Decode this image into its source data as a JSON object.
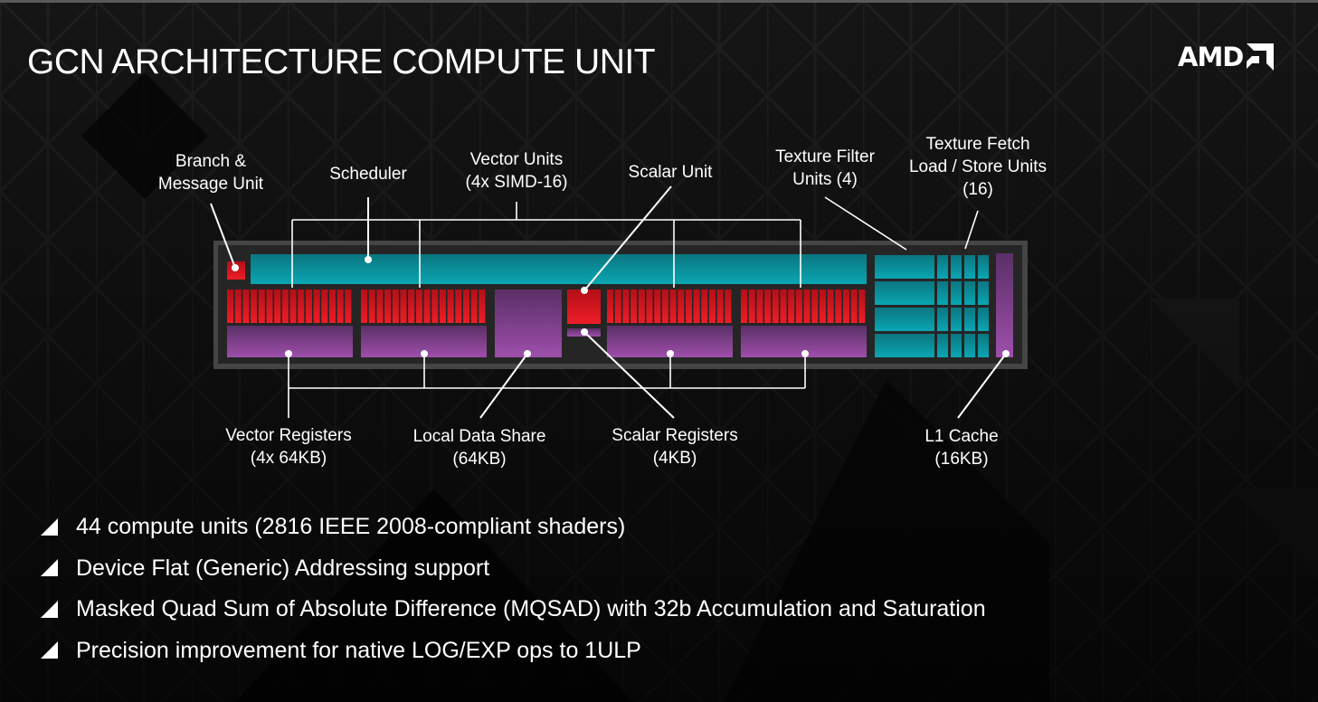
{
  "slide": {
    "title": "GCN ARCHITECTURE COMPUTE UNIT",
    "logo": {
      "text": "AMD",
      "icon": "amd-arrow-logo-icon"
    }
  },
  "diagram": {
    "colors": {
      "frame_outer": "#454545",
      "frame_inner": "#252525",
      "teal_top": "#0b7680",
      "teal_bottom": "#0aa6b3",
      "red_top": "#b30f17",
      "red_bottom": "#ee1d27",
      "purple_top": "#5a2f66",
      "purple_bottom": "#9e4fab",
      "callout_line": "#ffffff"
    },
    "simd_count": 4,
    "simd_lanes": 16,
    "texture_filter_units": 4,
    "texture_fetch_units": 16,
    "labels": {
      "branch": [
        "Branch &",
        "Message Unit"
      ],
      "scheduler": [
        "Scheduler"
      ],
      "vector_units": [
        "Vector Units",
        "(4x SIMD-16)"
      ],
      "scalar_unit": [
        "Scalar Unit"
      ],
      "texture_filter": [
        "Texture Filter",
        "Units (4)"
      ],
      "texture_fetch": [
        "Texture Fetch",
        "Load / Store Units",
        "(16)"
      ],
      "vector_registers": [
        "Vector Registers",
        "(4x 64KB)"
      ],
      "local_data_share": [
        "Local Data Share",
        "(64KB)"
      ],
      "scalar_registers": [
        "Scalar Registers",
        "(4KB)"
      ],
      "l1_cache": [
        "L1 Cache",
        "(16KB)"
      ]
    }
  },
  "bullets": {
    "icon": "triangle-bullet-icon",
    "items": [
      "44 compute units (2816 IEEE 2008-compliant shaders)",
      "Device Flat  (Generic) Addressing support",
      "Masked Quad Sum of Absolute Difference (MQSAD) with 32b Accumulation and Saturation",
      "Precision improvement for native LOG/EXP ops to 1ULP"
    ]
  }
}
